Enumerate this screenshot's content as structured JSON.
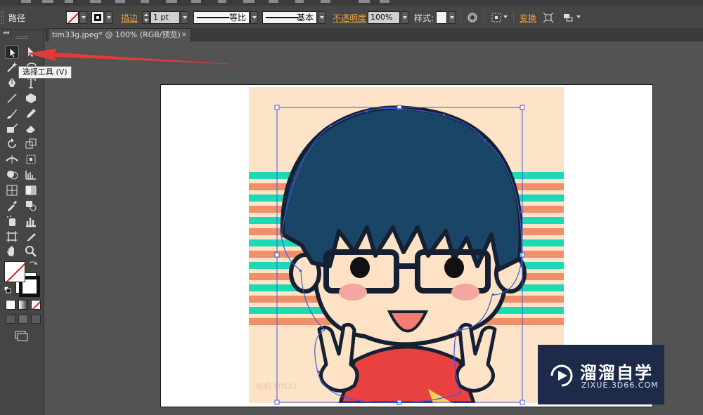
{
  "control_bar": {
    "object_type": "路径",
    "stroke_link": "描边",
    "stroke_weight": "1 pt",
    "variable_width_profile": "等比",
    "brush_definition": "基本",
    "opacity_link": "不透明度",
    "opacity_value": "100%",
    "style_label": "样式:",
    "transform_link": "变换"
  },
  "document_tab": {
    "title": "tim33g.jpeg* @ 100% (RGB/预览)",
    "close_glyph": "×"
  },
  "tools_panel": {
    "collapse_glyph": "◂◂",
    "tooltip": "选择工具 (V)"
  },
  "watermark": {
    "title": "溜溜自学",
    "subtitle": "ZIXUE.3D66.COM"
  },
  "artwork": {
    "signature_text": "哈莉 MYOU"
  },
  "colors": {
    "accent_link": "#e8a33a",
    "annotation_arrow": "#e23b3b",
    "selection": "#3d5bd9",
    "hair": "#1b4566",
    "background_peach": "#fde3c7",
    "stripe_teal": "#1fd9b4",
    "stripe_salmon": "#f0906a"
  }
}
